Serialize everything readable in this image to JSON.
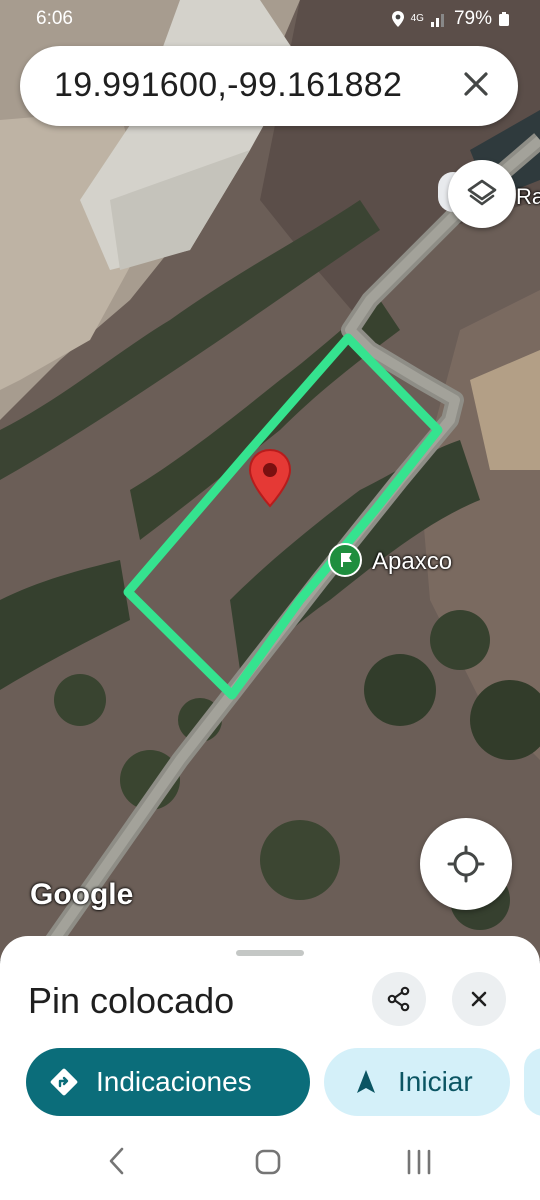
{
  "status_bar": {
    "time": "6:06",
    "network": "4G",
    "battery": "79%"
  },
  "search": {
    "query": "19.991600,-99.161882"
  },
  "map": {
    "place_labels": {
      "top_right": "Ra",
      "poi": "Apaxco"
    },
    "attribution": "Google",
    "colors": {
      "boundary": "#35e38f",
      "pin": "#e53935",
      "poi": "#1e8e3e"
    }
  },
  "sheet": {
    "title": "Pin colocado",
    "actions": {
      "directions": "Indicaciones",
      "start": "Iniciar"
    },
    "colors": {
      "primary": "#0b6d7a",
      "secondary": "#d4f0f9"
    }
  },
  "icons": {
    "close": "close-icon",
    "layers": "layers-icon",
    "locate": "my-location-icon",
    "share": "share-icon",
    "directions": "directions-icon",
    "navigate": "navigation-arrow-icon"
  }
}
